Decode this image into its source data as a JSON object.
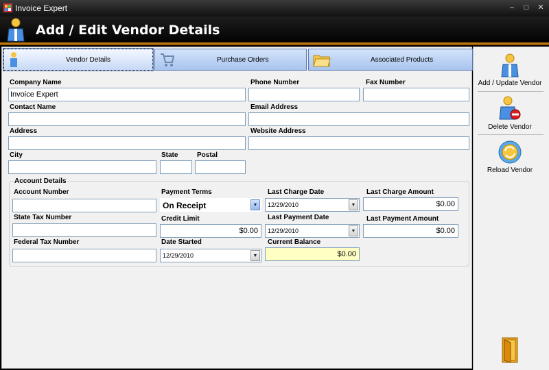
{
  "window": {
    "title": "Invoice Expert",
    "minimize": "–",
    "maximize": "□",
    "close": "✕"
  },
  "header": {
    "heading": "Add / Edit Vendor Details"
  },
  "tabs": [
    {
      "label": "Vendor Details",
      "active": true
    },
    {
      "label": "Purchase Orders",
      "active": false
    },
    {
      "label": "Associated Products",
      "active": false
    }
  ],
  "form": {
    "company_name": {
      "label": "Company Name",
      "value": "Invoice Expert"
    },
    "phone_number": {
      "label": "Phone Number",
      "value": ""
    },
    "fax_number": {
      "label": "Fax Number",
      "value": ""
    },
    "contact_name": {
      "label": "Contact Name",
      "value": ""
    },
    "email_address": {
      "label": "Email Address",
      "value": ""
    },
    "address": {
      "label": "Address",
      "value": ""
    },
    "website_address": {
      "label": "Website Address",
      "value": ""
    },
    "city": {
      "label": "City",
      "value": ""
    },
    "state": {
      "label": "State",
      "value": ""
    },
    "postal": {
      "label": "Postal",
      "value": ""
    }
  },
  "account": {
    "group_label": "Account Details",
    "account_number": {
      "label": "Account Number",
      "value": ""
    },
    "payment_terms": {
      "label": "Payment Terms",
      "value": "On Receipt"
    },
    "last_charge_date": {
      "label": "Last Charge Date",
      "value": "12/29/2010"
    },
    "last_charge_amount": {
      "label": "Last Charge Amount",
      "value": "$0.00"
    },
    "state_tax_number": {
      "label": "State Tax Number",
      "value": ""
    },
    "credit_limit": {
      "label": "Credit Limit",
      "value": "$0.00"
    },
    "last_payment_date": {
      "label": "Last Payment Date",
      "value": "12/29/2010"
    },
    "last_payment_amount": {
      "label": "Last Payment Amount",
      "value": "$0.00"
    },
    "federal_tax_number": {
      "label": "Federal Tax Number",
      "value": ""
    },
    "date_started": {
      "label": "Date Started",
      "value": "12/29/2010"
    },
    "current_balance": {
      "label": "Current Balance",
      "value": "$0.00"
    }
  },
  "sidebar": {
    "add_update": "Add / Update Vendor",
    "delete": "Delete Vendor",
    "reload": "Reload Vendor"
  },
  "colors": {
    "accent_orange": "#d98a0c",
    "tab_blue": "#a9c4ee",
    "balance_yellow": "#ffffc4"
  }
}
